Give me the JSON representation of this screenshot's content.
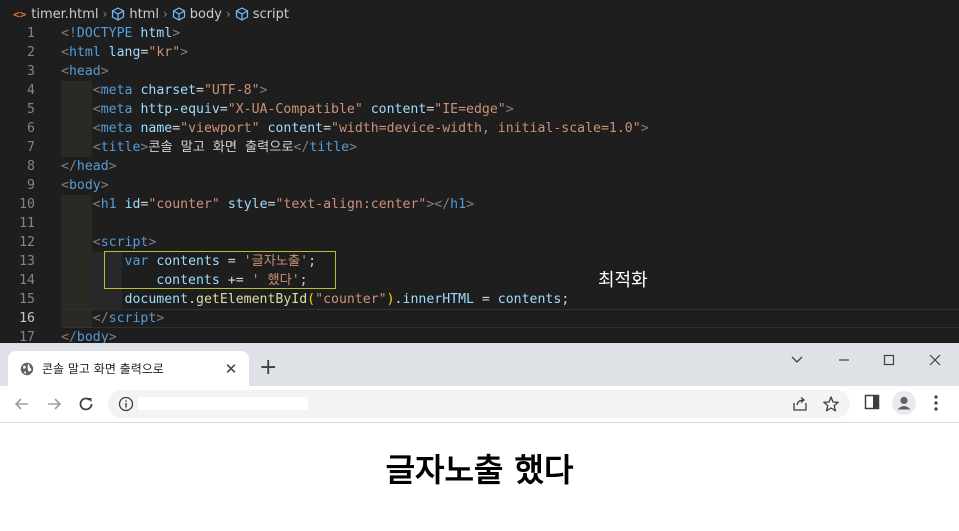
{
  "breadcrumb": {
    "items": [
      "timer.html",
      "html",
      "body",
      "script"
    ]
  },
  "editor": {
    "lines": [
      {
        "n": "1",
        "tokens": [
          [
            "t-tag",
            "<!"
          ],
          [
            "t-name",
            "DOCTYPE"
          ],
          [
            "t-txt",
            " "
          ],
          [
            "t-attr",
            "html"
          ],
          [
            "t-tag",
            ">"
          ]
        ]
      },
      {
        "n": "2",
        "tokens": [
          [
            "t-tag",
            "<"
          ],
          [
            "t-name",
            "html"
          ],
          [
            "t-txt",
            " "
          ],
          [
            "t-attr",
            "lang"
          ],
          [
            "t-txt",
            "="
          ],
          [
            "t-str",
            "\"kr\""
          ],
          [
            "t-tag",
            ">"
          ]
        ]
      },
      {
        "n": "3",
        "tokens": [
          [
            "t-tag",
            "<"
          ],
          [
            "t-name",
            "head"
          ],
          [
            "t-tag",
            ">"
          ]
        ]
      },
      {
        "n": "4",
        "tokens": [
          [
            "t-txt",
            "    "
          ],
          [
            "t-tag",
            "<"
          ],
          [
            "t-name",
            "meta"
          ],
          [
            "t-txt",
            " "
          ],
          [
            "t-attr",
            "charset"
          ],
          [
            "t-txt",
            "="
          ],
          [
            "t-str",
            "\"UTF-8\""
          ],
          [
            "t-tag",
            ">"
          ]
        ]
      },
      {
        "n": "5",
        "tokens": [
          [
            "t-txt",
            "    "
          ],
          [
            "t-tag",
            "<"
          ],
          [
            "t-name",
            "meta"
          ],
          [
            "t-txt",
            " "
          ],
          [
            "t-attr",
            "http-equiv"
          ],
          [
            "t-txt",
            "="
          ],
          [
            "t-str",
            "\"X-UA-Compatible\""
          ],
          [
            "t-txt",
            " "
          ],
          [
            "t-attr",
            "content"
          ],
          [
            "t-txt",
            "="
          ],
          [
            "t-str",
            "\"IE=edge\""
          ],
          [
            "t-tag",
            ">"
          ]
        ]
      },
      {
        "n": "6",
        "tokens": [
          [
            "t-txt",
            "    "
          ],
          [
            "t-tag",
            "<"
          ],
          [
            "t-name",
            "meta"
          ],
          [
            "t-txt",
            " "
          ],
          [
            "t-attr",
            "name"
          ],
          [
            "t-txt",
            "="
          ],
          [
            "t-str",
            "\"viewport\""
          ],
          [
            "t-txt",
            " "
          ],
          [
            "t-attr",
            "content"
          ],
          [
            "t-txt",
            "="
          ],
          [
            "t-str",
            "\"width=device-width, initial-scale=1.0\""
          ],
          [
            "t-tag",
            ">"
          ]
        ]
      },
      {
        "n": "7",
        "tokens": [
          [
            "t-txt",
            "    "
          ],
          [
            "t-tag",
            "<"
          ],
          [
            "t-name",
            "title"
          ],
          [
            "t-tag",
            ">"
          ],
          [
            "t-txt",
            "콘솔 말고 화면 출력으로"
          ],
          [
            "t-tag",
            "</"
          ],
          [
            "t-name",
            "title"
          ],
          [
            "t-tag",
            ">"
          ]
        ]
      },
      {
        "n": "8",
        "tokens": [
          [
            "t-tag",
            "</"
          ],
          [
            "t-name",
            "head"
          ],
          [
            "t-tag",
            ">"
          ]
        ]
      },
      {
        "n": "9",
        "tokens": [
          [
            "t-tag",
            "<"
          ],
          [
            "t-name",
            "body"
          ],
          [
            "t-tag",
            ">"
          ]
        ]
      },
      {
        "n": "10",
        "tokens": [
          [
            "t-txt",
            "    "
          ],
          [
            "t-tag",
            "<"
          ],
          [
            "t-name",
            "h1"
          ],
          [
            "t-txt",
            " "
          ],
          [
            "t-attr",
            "id"
          ],
          [
            "t-txt",
            "="
          ],
          [
            "t-str",
            "\"counter\""
          ],
          [
            "t-txt",
            " "
          ],
          [
            "t-attr",
            "style"
          ],
          [
            "t-txt",
            "="
          ],
          [
            "t-str",
            "\"text-align:center\""
          ],
          [
            "t-tag",
            "></"
          ],
          [
            "t-name",
            "h1"
          ],
          [
            "t-tag",
            ">"
          ]
        ]
      },
      {
        "n": "11",
        "tokens": []
      },
      {
        "n": "12",
        "tokens": [
          [
            "t-txt",
            "    "
          ],
          [
            "t-tag",
            "<"
          ],
          [
            "t-name",
            "script"
          ],
          [
            "t-tag",
            ">"
          ]
        ]
      },
      {
        "n": "13",
        "tokens": [
          [
            "t-txt",
            "        "
          ],
          [
            "t-kw",
            "var"
          ],
          [
            "t-txt",
            " "
          ],
          [
            "t-var",
            "contents"
          ],
          [
            "t-txt",
            " = "
          ],
          [
            "t-str",
            "'글자노출'"
          ],
          [
            "t-pun",
            ";"
          ]
        ]
      },
      {
        "n": "14",
        "tokens": [
          [
            "t-txt",
            "            "
          ],
          [
            "t-var",
            "contents"
          ],
          [
            "t-txt",
            " += "
          ],
          [
            "t-str",
            "' 했다'"
          ],
          [
            "t-pun",
            ";"
          ]
        ]
      },
      {
        "n": "15",
        "tokens": [
          [
            "t-txt",
            "        "
          ],
          [
            "t-var",
            "document"
          ],
          [
            "t-pun",
            "."
          ],
          [
            "t-fn",
            "getElementById"
          ],
          [
            "t-paren2",
            "("
          ],
          [
            "t-str",
            "\"counter\""
          ],
          [
            "t-paren2",
            ")"
          ],
          [
            "t-pun",
            "."
          ],
          [
            "t-var",
            "innerHTML"
          ],
          [
            "t-txt",
            " = "
          ],
          [
            "t-var",
            "contents"
          ],
          [
            "t-pun",
            ";"
          ]
        ]
      },
      {
        "n": "16",
        "tokens": [
          [
            "t-txt",
            "    "
          ],
          [
            "t-tag",
            "</"
          ],
          [
            "t-name",
            "script"
          ],
          [
            "t-tag",
            ">"
          ]
        ]
      },
      {
        "n": "17",
        "tokens": [
          [
            "t-tag",
            "</"
          ],
          [
            "t-name",
            "body"
          ],
          [
            "t-tag",
            ">"
          ]
        ]
      }
    ],
    "current_line": "16",
    "annotation": "최적화"
  },
  "browser": {
    "tab_title": "콘솔 말고 화면 출력으로",
    "page_heading": "글자노출 했다",
    "colors": {
      "tabstrip": "#dee1e6",
      "accent": "#1a73e8"
    }
  }
}
